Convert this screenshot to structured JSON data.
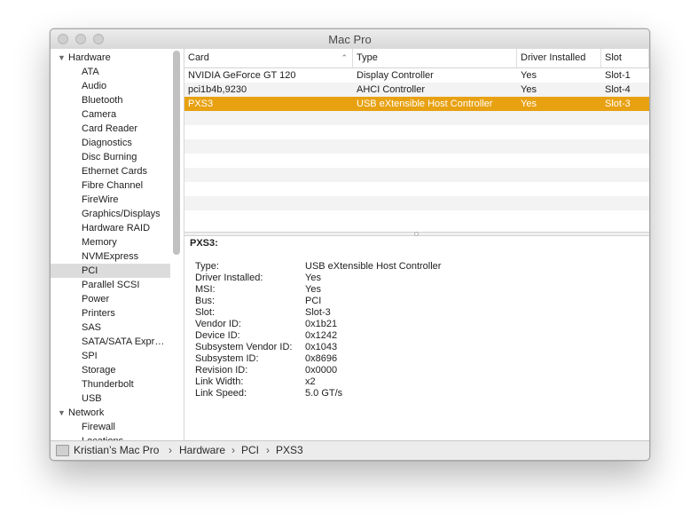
{
  "window": {
    "title": "Mac Pro",
    "traffic_light_color": "#cfcfcf"
  },
  "sidebar": {
    "groups": [
      {
        "label": "Hardware",
        "expanded": true,
        "items": [
          "ATA",
          "Audio",
          "Bluetooth",
          "Camera",
          "Card Reader",
          "Diagnostics",
          "Disc Burning",
          "Ethernet Cards",
          "Fibre Channel",
          "FireWire",
          "Graphics/Displays",
          "Hardware RAID",
          "Memory",
          "NVMExpress",
          "PCI",
          "Parallel SCSI",
          "Power",
          "Printers",
          "SAS",
          "SATA/SATA Expr…",
          "SPI",
          "Storage",
          "Thunderbolt",
          "USB"
        ]
      },
      {
        "label": "Network",
        "expanded": true,
        "items": [
          "Firewall",
          "Locations"
        ]
      }
    ],
    "selected_item": "PCI",
    "disclosure_icon": "disclosure-triangle-down"
  },
  "table": {
    "columns": [
      "Card",
      "Type",
      "Driver Installed",
      "Slot"
    ],
    "sort_column": "Card",
    "sort_icon": "sort-ascending-chevron",
    "rows": [
      [
        "NVIDIA GeForce GT 120",
        "Display Controller",
        "Yes",
        "Slot-1"
      ],
      [
        "pci1b4b,9230",
        "AHCI Controller",
        "Yes",
        "Slot-4"
      ],
      [
        "PXS3",
        "USB eXtensible Host Controller",
        "Yes",
        "Slot-3"
      ]
    ],
    "selected_row": 2,
    "selection_color": "#e8a111"
  },
  "detail": {
    "title": "PXS3:",
    "properties": [
      {
        "key": "Type:",
        "value": "USB eXtensible Host Controller"
      },
      {
        "key": "Driver Installed:",
        "value": "Yes"
      },
      {
        "key": "MSI:",
        "value": "Yes"
      },
      {
        "key": "Bus:",
        "value": "PCI"
      },
      {
        "key": "Slot:",
        "value": "Slot-3"
      },
      {
        "key": "Vendor ID:",
        "value": "0x1b21"
      },
      {
        "key": "Device ID:",
        "value": "0x1242"
      },
      {
        "key": "Subsystem Vendor ID:",
        "value": "0x1043"
      },
      {
        "key": "Subsystem ID:",
        "value": "0x8696"
      },
      {
        "key": "Revision ID:",
        "value": "0x0000"
      },
      {
        "key": "Link Width:",
        "value": "x2"
      },
      {
        "key": "Link Speed:",
        "value": "5.0 GT/s"
      }
    ]
  },
  "pathbar": {
    "icon": "computer-icon",
    "items": [
      "Kristian’s Mac Pro",
      "Hardware",
      "PCI",
      "PXS3"
    ],
    "separator": "›"
  }
}
